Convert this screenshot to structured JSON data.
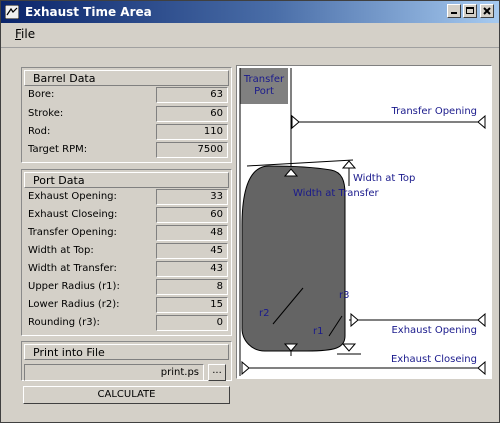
{
  "window": {
    "title": "Exhaust Time Area"
  },
  "menu": {
    "file_label": "File",
    "file_mnemonic": "F",
    "file_rest": "ile"
  },
  "barrel": {
    "title": "Barrel Data",
    "rows": [
      {
        "label": "Bore:",
        "value": "63"
      },
      {
        "label": "Stroke:",
        "value": "60"
      },
      {
        "label": "Rod:",
        "value": "110"
      },
      {
        "label": "Target RPM:",
        "value": "7500"
      }
    ]
  },
  "port": {
    "title": "Port Data",
    "rows": [
      {
        "label": "Exhaust Opening:",
        "value": "33"
      },
      {
        "label": "Exhaust Closeing:",
        "value": "60"
      },
      {
        "label": "Transfer Opening:",
        "value": "48"
      },
      {
        "label": "Width at Top:",
        "value": "45"
      },
      {
        "label": "Width at Transfer:",
        "value": "43"
      },
      {
        "label": "Upper Radius (r1):",
        "value": "8"
      },
      {
        "label": "Lower Radius (r2):",
        "value": "15"
      },
      {
        "label": "Rounding (r3):",
        "value": "0"
      }
    ]
  },
  "print": {
    "title": "Print into File",
    "filename": "print.ps",
    "browse_label": "..."
  },
  "calculate_label": "CALCULATE",
  "diagram": {
    "transfer_port": "Transfer\nPort",
    "transfer_port_l1": "Transfer",
    "transfer_port_l2": "Port",
    "transfer_opening": "Transfer Opening",
    "width_at_top": "Width at Top",
    "width_at_transfer": "Width at Transfer",
    "exhaust_opening": "Exhaust Opening",
    "exhaust_closeing": "Exhaust Closeing",
    "r1": "r1",
    "r2": "r2",
    "r3": "r3",
    "colors": {
      "port_fill": "#646464",
      "transfer_box": "#808080",
      "label_text": "#1a1a8c"
    }
  }
}
